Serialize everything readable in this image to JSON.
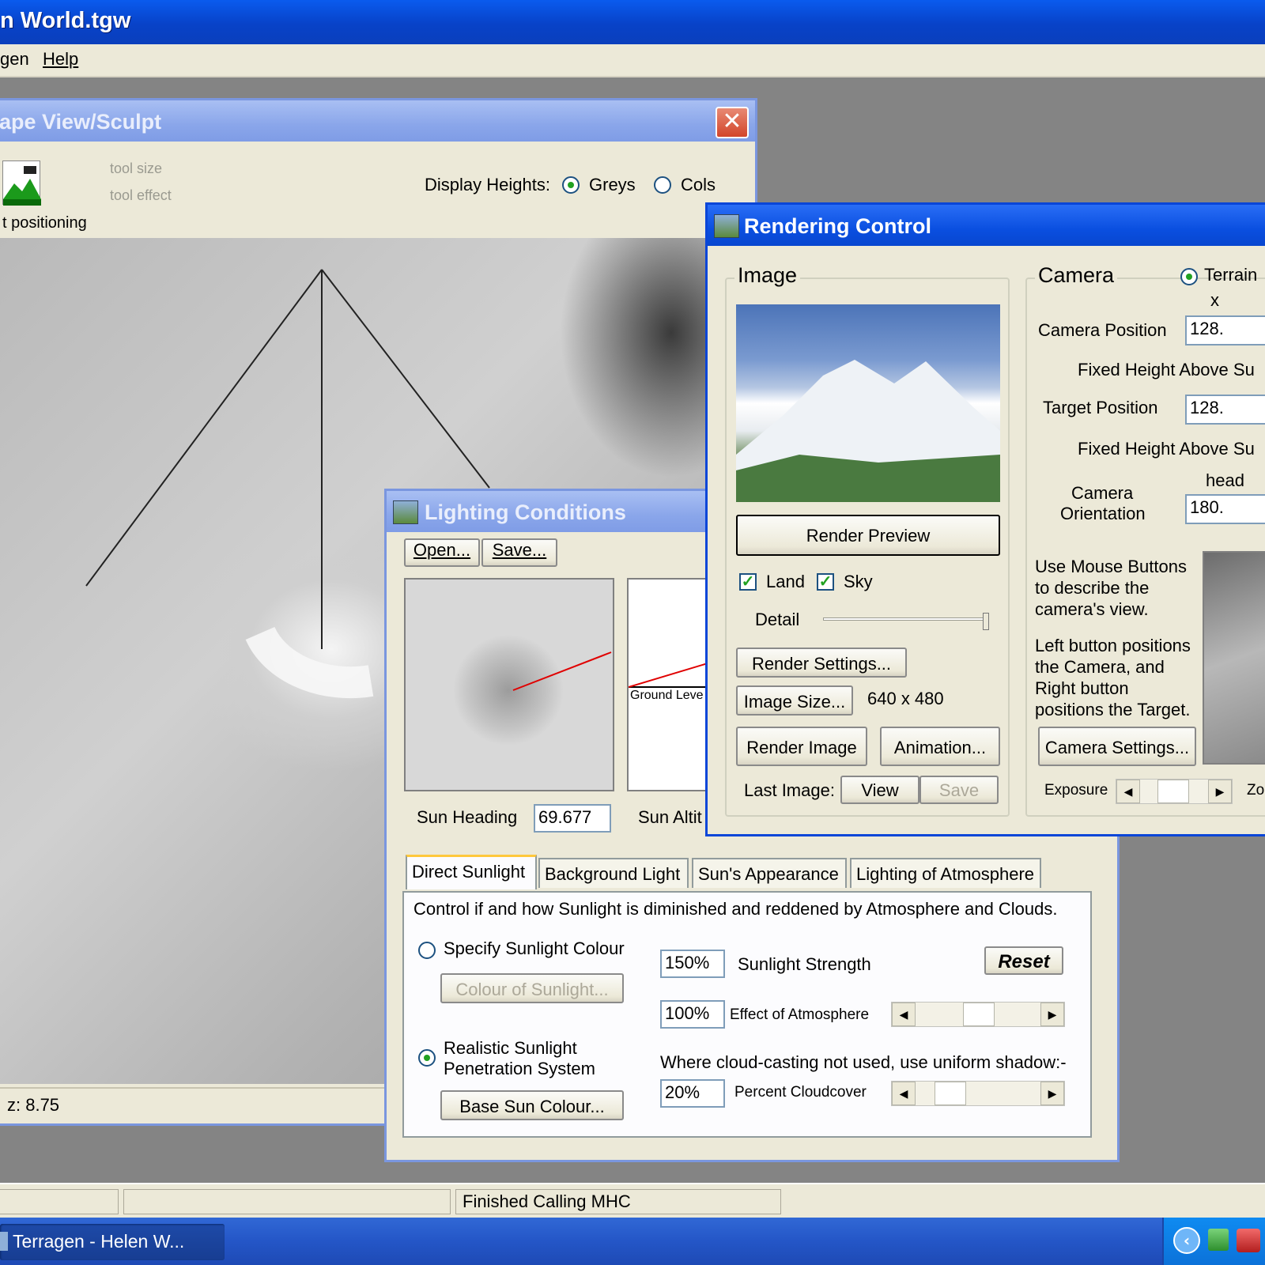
{
  "app": {
    "title": "n World.tgw"
  },
  "menu": {
    "items": [
      "gen",
      "Help"
    ]
  },
  "landscape": {
    "title": "ape View/Sculpt",
    "tool_size": "tool size",
    "tool_effect": "tool effect",
    "positioning": "t positioning",
    "display_heights_label": "Display Heights:",
    "greys": "Greys",
    "cols": "Cols",
    "z_readout": "z: 8.75"
  },
  "lighting": {
    "title": "Lighting Conditions",
    "open": "Open...",
    "save": "Save...",
    "ground_level": "Ground Leve",
    "sun_heading_label": "Sun Heading",
    "sun_heading_value": "69.677",
    "sun_altitude_label": "Sun Altit",
    "tabs": [
      "Direct Sunlight",
      "Background Light",
      "Sun's Appearance",
      "Lighting of Atmosphere"
    ],
    "description": "Control if and how Sunlight is diminished and reddened by Atmosphere and Clouds.",
    "specify_colour": "Specify Sunlight Colour",
    "colour_of_sunlight": "Colour of Sunlight...",
    "realistic_line1": "Realistic Sunlight",
    "realistic_line2": "Penetration System",
    "base_sun_colour": "Base Sun Colour...",
    "sunlight_strength_value": "150%",
    "sunlight_strength_label": "Sunlight Strength",
    "reset": "Reset",
    "effect_atmosphere_value": "100%",
    "effect_atmosphere_label": "Effect of Atmosphere",
    "effect_atmosphere_level": 0.5,
    "cloud_note": "Where cloud-casting not used, use uniform shadow:-",
    "cloudcover_value": "20%",
    "cloudcover_label": "Percent Cloudcover",
    "cloudcover_level": 0.2
  },
  "rendering": {
    "title": "Rendering Control",
    "image_group": "Image",
    "render_preview": "Render Preview",
    "land": "Land",
    "sky": "Sky",
    "detail": "Detail",
    "detail_level": 1.0,
    "render_settings": "Render Settings...",
    "image_size": "Image Size...",
    "image_size_value": "640 x 480",
    "render_image": "Render Image",
    "animation": "Animation...",
    "last_image": "Last Image:",
    "view": "View",
    "save": "Save",
    "camera_group": "Camera",
    "terrain": "Terrain",
    "x_header": "x",
    "camera_position_label": "Camera Position",
    "camera_position_x": "128.",
    "fixed_height_1": "Fixed Height Above Su",
    "target_position_label": "Target Position",
    "target_position_x": "128.",
    "fixed_height_2": "Fixed Height Above Su",
    "head_header": "head",
    "camera_orientation_line1": "Camera",
    "camera_orientation_line2": "Orientation",
    "orientation_head": "180.",
    "help_1": [
      "Use Mouse Buttons",
      "to describe the",
      "camera's view."
    ],
    "help_2": [
      "Left button positions",
      "the Camera, and",
      "Right button",
      "positions the Target."
    ],
    "camera_settings": "Camera Settings...",
    "exposure": "Exposure",
    "zoom_cut": "Zo"
  },
  "status": {
    "message": "Finished Calling MHC"
  },
  "taskbar": {
    "task": "Terragen  -  Helen W..."
  }
}
